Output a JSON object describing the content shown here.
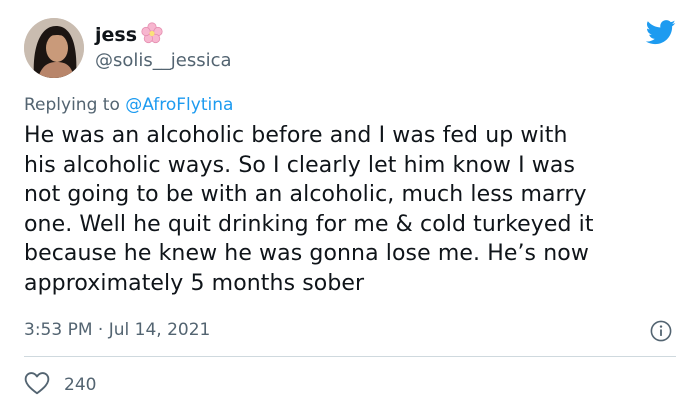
{
  "author": {
    "display_name": "jess",
    "name_emoji": "cherry-blossom-emoji",
    "handle": "@solis__jessica"
  },
  "reply": {
    "prefix": "Replying to",
    "mention": "@AfroFlytina"
  },
  "tweet": {
    "lines": [
      "He was an alcoholic before and I was fed up with",
      "his alcoholic ways. So I clearly let him know I was",
      "not going to be with an alcoholic, much less marry",
      "one. Well he quit drinking for me & cold turkeyed it",
      "because he knew he was gonna lose me. He’s now",
      "approximately 5 months sober"
    ]
  },
  "timestamp": "3:53 PM · Jul 14, 2021",
  "likes": "240",
  "colors": {
    "twitter_blue": "#1d9bf0",
    "secondary_text": "#536471",
    "divider": "#cfd9de"
  }
}
